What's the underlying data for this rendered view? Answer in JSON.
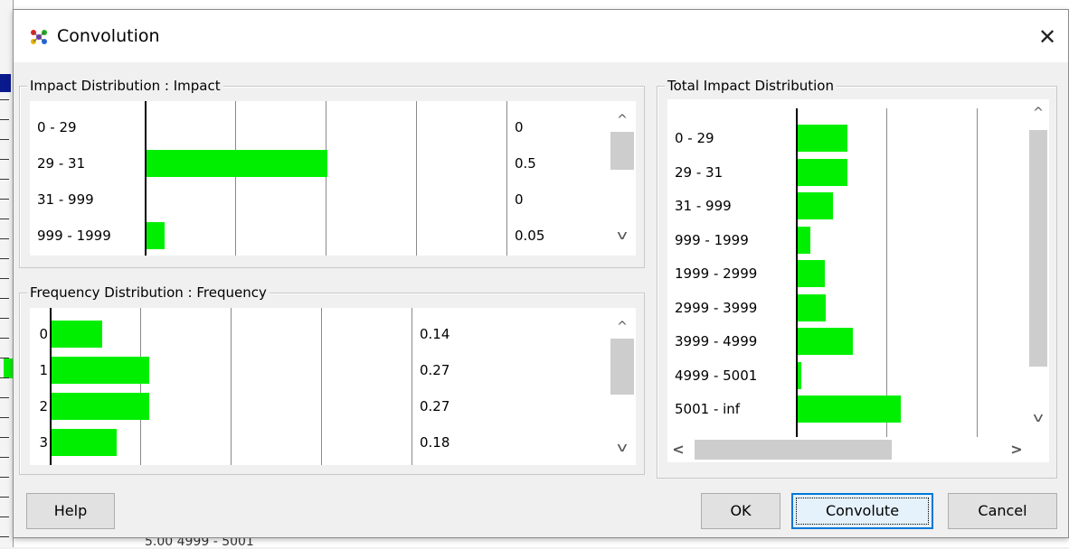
{
  "dialog": {
    "title": "Convolution",
    "close_label": "✕",
    "accent_color": "#0078d7",
    "bar_color": "#00ef00"
  },
  "background": {
    "partial_text": "5.00 4999 - 5001"
  },
  "impact_panel": {
    "legend": "Impact Distribution : Impact",
    "rows": [
      {
        "label": "0 - 29",
        "value": "0",
        "fraction": 0
      },
      {
        "label": "29 - 31",
        "value": "0.5",
        "fraction": 0.5
      },
      {
        "label": "31 - 999",
        "value": "0",
        "fraction": 0
      },
      {
        "label": "999 - 1999",
        "value": "0.05",
        "fraction": 0.05
      }
    ]
  },
  "frequency_panel": {
    "legend": "Frequency Distribution : Frequency",
    "rows": [
      {
        "label": "0",
        "value": "0.14",
        "fraction": 0.14
      },
      {
        "label": "1",
        "value": "0.27",
        "fraction": 0.27
      },
      {
        "label": "2",
        "value": "0.27",
        "fraction": 0.27
      },
      {
        "label": "3",
        "value": "0.18",
        "fraction": 0.18
      }
    ]
  },
  "total_panel": {
    "legend": "Total Impact Distribution",
    "rows": [
      {
        "label": "0 - 29",
        "fraction": 0.055
      },
      {
        "label": "29 - 31",
        "fraction": 0.055
      },
      {
        "label": "31 - 999",
        "fraction": 0.039
      },
      {
        "label": "999 - 1999",
        "fraction": 0.014
      },
      {
        "label": "1999 - 2999",
        "fraction": 0.03
      },
      {
        "label": "2999 - 3999",
        "fraction": 0.031
      },
      {
        "label": "3999 - 4999",
        "fraction": 0.061
      },
      {
        "label": "4999 - 5001",
        "fraction": 0.004
      },
      {
        "label": "5001 - inf",
        "fraction": 0.114
      }
    ]
  },
  "scroll": {
    "up": "^",
    "down": "v",
    "left": "<",
    "right": ">"
  },
  "buttons": {
    "help": "Help",
    "ok": "OK",
    "convolute": "Convolute",
    "cancel": "Cancel"
  }
}
